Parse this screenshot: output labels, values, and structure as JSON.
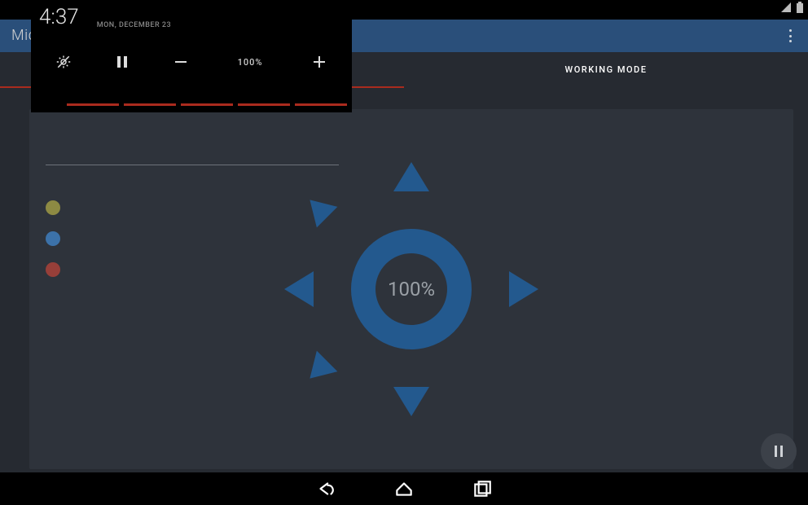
{
  "statusbar": {},
  "appbar": {
    "title": "Mid"
  },
  "panel": {
    "time": "4:37",
    "date": "MON, DECEMBER 23",
    "brightness_label": "100%"
  },
  "tabs": {
    "left_label": "",
    "right_label": "WORKING MODE"
  },
  "sun": {
    "pct": "100%"
  },
  "legend": {
    "items": [
      {
        "color": "yellow"
      },
      {
        "color": "blue"
      },
      {
        "color": "red"
      }
    ]
  }
}
